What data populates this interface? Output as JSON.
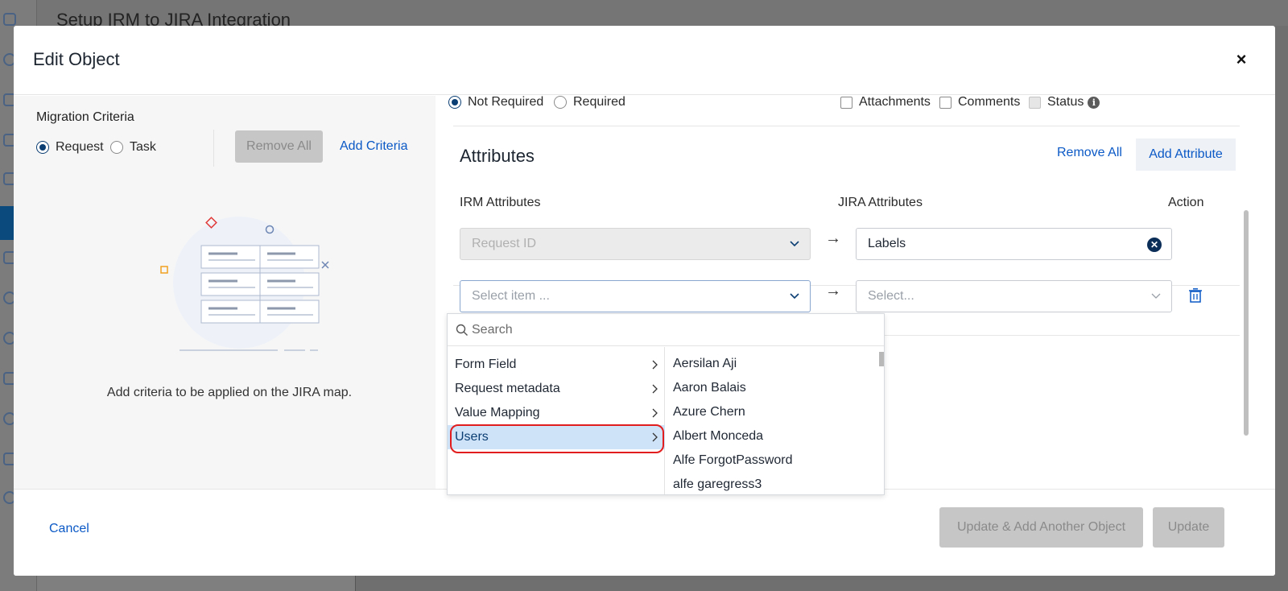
{
  "background": {
    "page_title": "Setup IRM to JIRA Integration"
  },
  "modal": {
    "title": "Edit Object",
    "close_icon": "×"
  },
  "left_panel": {
    "section_label": "Migration Criteria",
    "radio_request": "Request",
    "radio_task": "Task",
    "selected_radio": "Request",
    "remove_all": "Remove All",
    "add_criteria": "Add Criteria",
    "empty_message": "Add criteria to be applied on the JIRA map."
  },
  "right_panel": {
    "radio_not_required": "Not Required",
    "radio_required": "Required",
    "selected_radio": "Not Required",
    "checkboxes": {
      "attachments": "Attachments",
      "comments": "Comments",
      "status": "Status"
    },
    "info_icon": "i",
    "attributes_title": "Attributes",
    "remove_all": "Remove All",
    "add_attribute": "Add Attribute",
    "col_irm": "IRM Attributes",
    "col_jira": "JIRA Attributes",
    "col_action": "Action",
    "row1": {
      "irm_value": "Request ID",
      "jira_value": "Labels",
      "arrow": "→"
    },
    "row2": {
      "irm_placeholder": "Select item ...",
      "jira_placeholder": "Select...",
      "arrow": "→"
    }
  },
  "dropdown": {
    "search_placeholder": "Search",
    "categories": [
      {
        "label": "Form Field"
      },
      {
        "label": "Request metadata"
      },
      {
        "label": "Value Mapping"
      },
      {
        "label": "Users"
      }
    ],
    "selected_category": "Users",
    "users": [
      "Aersilan Aji",
      "Aaron Balais",
      "Azure Chern",
      "Albert Monceda",
      "Alfe ForgotPassword",
      "alfe garegress3"
    ]
  },
  "footer": {
    "cancel": "Cancel",
    "update_add_another": "Update & Add Another Object",
    "update": "Update"
  },
  "colors": {
    "link_blue": "#0b59c6",
    "radio_navy": "#0b3e73",
    "disabled_gray": "#c6c6c6",
    "highlight_red": "#e21d1d",
    "selected_bg": "#cfe3f8"
  }
}
